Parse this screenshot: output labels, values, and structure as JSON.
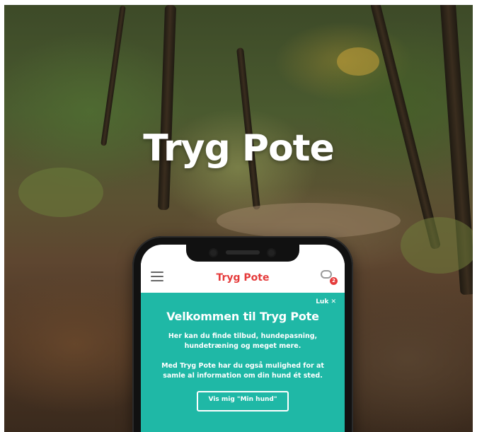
{
  "hero": {
    "title": "Tryg Pote"
  },
  "app": {
    "title": "Tryg Pote",
    "notification_count": "2",
    "accent_color": "#e53b3b",
    "panel_color": "#1fb8a6"
  },
  "welcome": {
    "close_label": "Luk ✕",
    "heading": "Velkommen til Tryg Pote",
    "text1": "Her kan du finde tilbud, hundepasning, hundetræning og meget mere.",
    "text2": "Med Tryg Pote har du også mulighed for at samle al information om din hund ét sted.",
    "cta_label": "Vis mig \"Min hund\""
  },
  "icons": [
    "hamburger-menu-icon",
    "chat-icon"
  ]
}
